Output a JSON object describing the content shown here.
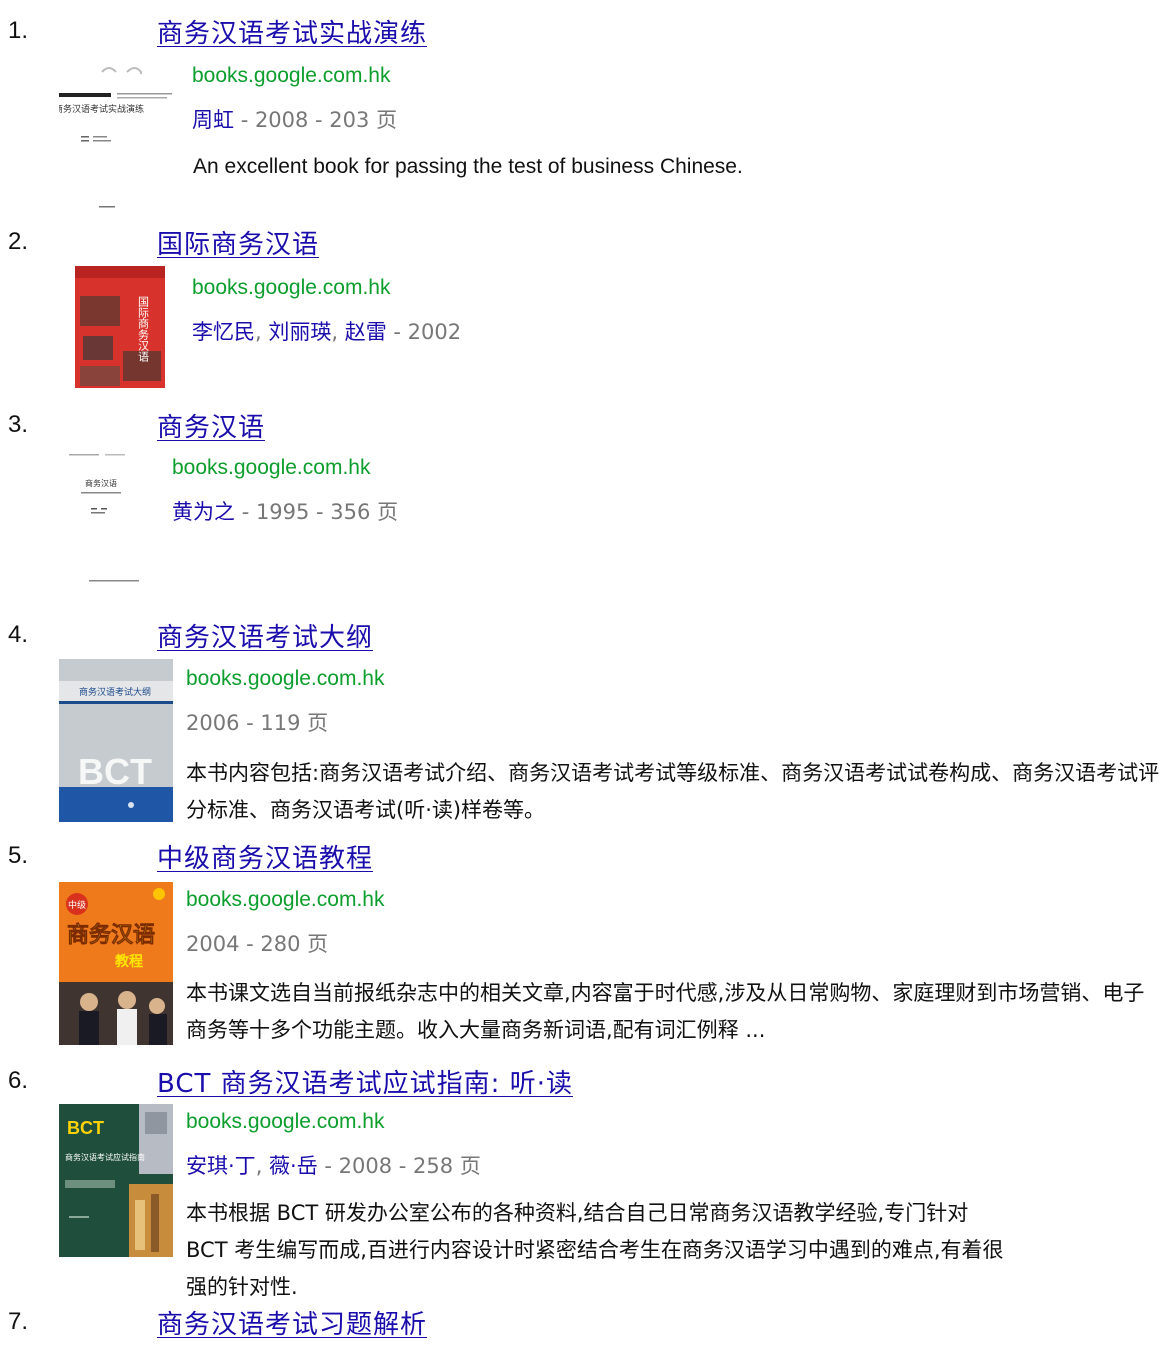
{
  "results": [
    {
      "number": "1.",
      "title": "商务汉语考试实战演练",
      "site": "books.google.com.hk",
      "authors": [
        "周虹"
      ],
      "meta_tail": "- 2008 - 203",
      "page_unit": "页",
      "description": "An excellent book for passing the test of business Chinese."
    },
    {
      "number": "2.",
      "title": "国际商务汉语",
      "site": "books.google.com.hk",
      "authors": [
        "李忆民",
        "刘丽瑛",
        "赵雷"
      ],
      "meta_tail": "- 2002",
      "page_unit": ""
    },
    {
      "number": "3.",
      "title": "商务汉语",
      "site": "books.google.com.hk",
      "authors": [
        "黄为之"
      ],
      "meta_tail": "- 1995 - 356",
      "page_unit": "页"
    },
    {
      "number": "4.",
      "title": "商务汉语考试大纲",
      "site": "books.google.com.hk",
      "meta_tail": "2006 - 119",
      "page_unit": "页",
      "description": "本书内容包括:商务汉语考试介绍、商务汉语考试考试等级标准、商务汉语考试试卷构成、商务汉语考试评分标准、商务汉语考试(听·读)样卷等。"
    },
    {
      "number": "5.",
      "title": "中级商务汉语教程",
      "site": "books.google.com.hk",
      "meta_tail": "2004 - 280",
      "page_unit": "页",
      "description": "本书课文选自当前报纸杂志中的相关文章,内容富于时代感,涉及从日常购物、家庭理财到市场营销、电子商务等十多个功能主题。收入大量商务新词语,配有词汇例释 ..."
    },
    {
      "number": "6.",
      "title": "BCT 商务汉语考试应试指南: 听·读",
      "site": "books.google.com.hk",
      "authors": [
        "安琪·丁",
        "薇·岳"
      ],
      "meta_tail": "- 2008 - 258",
      "page_unit": "页",
      "description": "本书根据 BCT 研发办公室公布的各种资料,结合自己日常商务汉语教学经验,专门针对 BCT 考生编写而成,百进行内容设计时紧密结合考生在商务汉语学习中遇到的难点,有着很强的针对性."
    },
    {
      "number": "7.",
      "title": "商务汉语考试习题解析"
    }
  ],
  "covers": [
    {
      "text": "商务汉语考试实战演练",
      "bg": "#f4f4f4"
    },
    {
      "text": "国际商务汉语",
      "bg": "#d8322c"
    },
    {
      "text": "商务汉语",
      "bg": "#f6f6f6"
    },
    {
      "text": "商务汉语考试大纲",
      "bg": "#c6cbcf",
      "logo": "BCT"
    },
    {
      "text": "商务汉语",
      "bg": "#ee7a1c",
      "subtitle": "中级",
      "footer": "教程"
    },
    {
      "text": "商务汉语考试应试指南",
      "bg": "#1f4f3c",
      "logo": "BCT"
    }
  ],
  "colors": {
    "link": "#1a0dab",
    "site": "#0d9e2d",
    "meta": "#777777",
    "text": "#111111"
  }
}
